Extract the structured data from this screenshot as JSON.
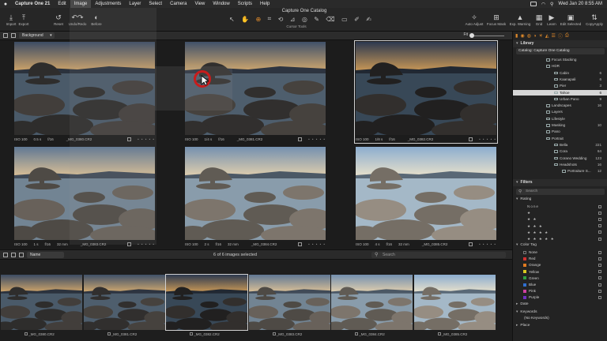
{
  "menubar": {
    "app": "Capture One 21",
    "items": [
      "Edit",
      "Image",
      "Adjustments",
      "Layer",
      "Select",
      "Camera",
      "View",
      "Window",
      "Scripts",
      "Help"
    ],
    "active": "Image",
    "clock": "Wed Jan 20  8:55 AM"
  },
  "toolbar": {
    "title": "Capture One Catalog",
    "left": [
      {
        "label": "Import",
        "icon": "import-icon"
      },
      {
        "label": "Export",
        "icon": "export-icon"
      },
      {
        "label": "Reset",
        "icon": "reset-icon"
      },
      {
        "label": "Undo/Redo",
        "icon": "undo-redo-icon"
      },
      {
        "label": "Before",
        "icon": "before-icon"
      }
    ],
    "cursor_tools_label": "Cursor Tools",
    "right": [
      {
        "label": "Auto Adjust",
        "icon": "auto-adjust-icon"
      },
      {
        "label": "Focus Mask",
        "icon": "focus-mask-icon"
      },
      {
        "label": "Exp. Warning",
        "icon": "exposure-warning-icon"
      },
      {
        "label": "Grid",
        "icon": "grid-icon"
      },
      {
        "label": "Learn",
        "icon": "learn-icon"
      },
      {
        "label": "Edit Selected",
        "icon": "edit-selected-icon"
      },
      {
        "label": "CopyApply",
        "icon": "copy-apply-icon"
      }
    ]
  },
  "subbar": {
    "background": "Background",
    "fit": "Fit"
  },
  "viewer": {
    "cells": [
      {
        "iso": "ISO 100",
        "shutter": "0.5 s",
        "aperture": "f/16",
        "focal": "",
        "file": "_MG_0380.CR2",
        "selected": false
      },
      {
        "iso": "ISO 100",
        "shutter": "1/4 s",
        "aperture": "f/16",
        "focal": "",
        "file": "_MG_0381.CR2",
        "selected": false
      },
      {
        "iso": "ISO 100",
        "shutter": "1/8 s",
        "aperture": "f/16",
        "focal": "",
        "file": "_MG_0382.CR2",
        "selected": true
      },
      {
        "iso": "ISO 100",
        "shutter": "1 s",
        "aperture": "f/16",
        "focal": "32 mm",
        "file": "_MG_0383.CR2",
        "selected": false
      },
      {
        "iso": "ISO 100",
        "shutter": "2 s",
        "aperture": "f/16",
        "focal": "32 mm",
        "file": "_MG_0384.CR2",
        "selected": false
      },
      {
        "iso": "ISO 100",
        "shutter": "4 s",
        "aperture": "f/16",
        "focal": "32 mm",
        "file": "_MG_0385.CR2",
        "selected": false
      }
    ]
  },
  "filmbar": {
    "sort": "Name",
    "count": "6 of 6 images selected",
    "search_placeholder": "Search"
  },
  "filmstrip": {
    "files": [
      "_MG_0380.CR2",
      "_MG_0381.CR2",
      "_MG_0382.CR2",
      "_MG_0383.CR2",
      "_MG_0384.CR2",
      "_MG_0385.CR2"
    ]
  },
  "library": {
    "header": "Library",
    "catalog": "Catalog: Capture One Catalog",
    "rows": [
      {
        "name": "Focus Stacking",
        "count": "",
        "indent": 2
      },
      {
        "name": "HDR",
        "count": "",
        "indent": 2
      },
      {
        "name": "Cabin",
        "count": "6",
        "indent": 3
      },
      {
        "name": "Kaanapali",
        "count": "6",
        "indent": 3
      },
      {
        "name": "Pier",
        "count": "3",
        "indent": 3
      },
      {
        "name": "Tahoe",
        "count": "6",
        "indent": 3,
        "highlight": true
      },
      {
        "name": "Urban Pano",
        "count": "9",
        "indent": 3
      },
      {
        "name": "Landscapes",
        "count": "16",
        "indent": 2
      },
      {
        "name": "Layers",
        "count": "",
        "indent": 2
      },
      {
        "name": "Lifestyle",
        "count": "",
        "indent": 2
      },
      {
        "name": "Masking",
        "count": "10",
        "indent": 2
      },
      {
        "name": "Pano",
        "count": "",
        "indent": 2
      },
      {
        "name": "Portrait",
        "count": "",
        "indent": 2
      },
      {
        "name": "Bella",
        "count": "221",
        "indent": 3
      },
      {
        "name": "Cora",
        "count": "64",
        "indent": 3
      },
      {
        "name": "Corano Wedding",
        "count": "123",
        "indent": 3
      },
      {
        "name": "Headshots",
        "count": "16",
        "indent": 3
      },
      {
        "name": "Portraiture S...",
        "count": "12",
        "indent": 4
      }
    ]
  },
  "filters": {
    "header": "Filters",
    "search_placeholder": "Search",
    "rating_label": "Rating",
    "ratings": [
      "None",
      "★",
      "★ ★",
      "★ ★ ★",
      "★ ★ ★ ★",
      "★ ★ ★ ★ ★"
    ],
    "color_tag_label": "Color Tag",
    "color_tags": [
      {
        "name": "None",
        "color": ""
      },
      {
        "name": "Red",
        "color": "#d03030"
      },
      {
        "name": "Orange",
        "color": "#e07a20"
      },
      {
        "name": "Yellow",
        "color": "#d8c820"
      },
      {
        "name": "Green",
        "color": "#30a040"
      },
      {
        "name": "Blue",
        "color": "#2f6fd0"
      },
      {
        "name": "Pink",
        "color": "#d040a0"
      },
      {
        "name": "Purple",
        "color": "#7030c0"
      }
    ],
    "date_label": "Date",
    "keywords_label": "Keywords",
    "keywords_value": "(No Keywords)",
    "place_label": "Place"
  },
  "colors": {
    "accent": "#e08a2a",
    "click_ring": "#c81c1c"
  }
}
